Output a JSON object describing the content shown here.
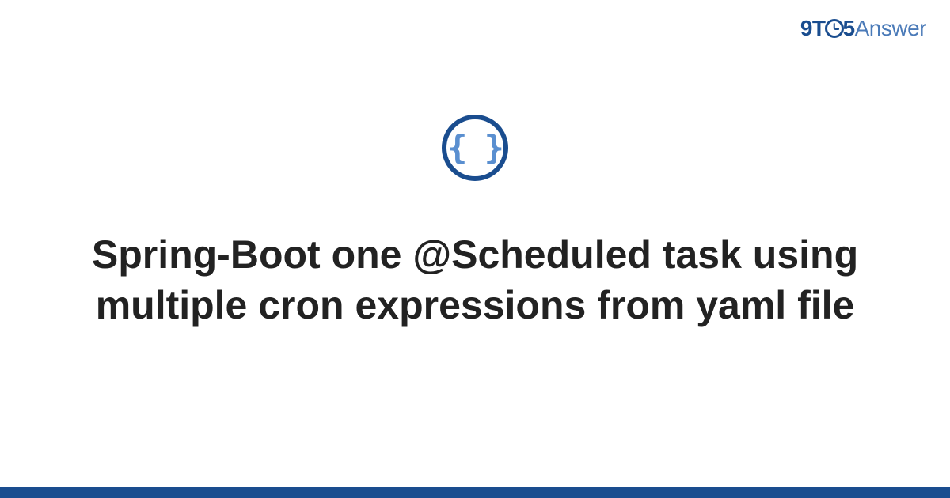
{
  "brand": {
    "part1": "9T",
    "part2": "5",
    "part3": "Answer"
  },
  "icon": {
    "glyph": "{ }"
  },
  "title": "Spring-Boot one @Scheduled task using multiple cron expressions from yaml file",
  "colors": {
    "primary": "#1a4d8f",
    "secondary": "#4a7ab8",
    "iconBrace": "#5a8fd0",
    "text": "#222222"
  }
}
